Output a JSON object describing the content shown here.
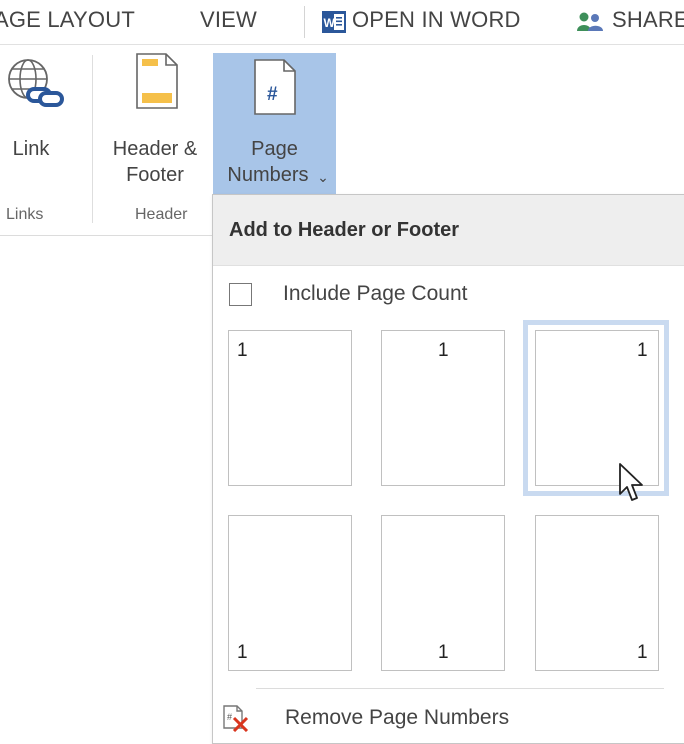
{
  "tabs": {
    "page_layout": "AGE LAYOUT",
    "view": "VIEW",
    "open_in_word": "OPEN IN WORD",
    "share": "SHARE"
  },
  "ribbon": {
    "link_label": "Link",
    "header_footer_line1": "Header &",
    "header_footer_line2": "Footer",
    "page_numbers_line1": "Page",
    "page_numbers_line2": "Numbers",
    "page_numbers_caret": "⌄",
    "groups": {
      "links": "Links",
      "header": "Header"
    }
  },
  "dropdown": {
    "header": "Add to Header or Footer",
    "include_page_count": "Include Page Count",
    "include_page_count_checked": false,
    "thumbs": [
      {
        "number": "1",
        "position": "top-left"
      },
      {
        "number": "1",
        "position": "top-center"
      },
      {
        "number": "1",
        "position": "top-right"
      },
      {
        "number": "1",
        "position": "bottom-left"
      },
      {
        "number": "1",
        "position": "bottom-center"
      },
      {
        "number": "1",
        "position": "bottom-right"
      }
    ],
    "remove_label": "Remove Page Numbers"
  },
  "colors": {
    "selected_button": "#a8c5e8",
    "hover_ring": "#c9daf0",
    "word_blue": "#2b579a",
    "remove_red": "#d9361f"
  },
  "icons": [
    "link-icon",
    "header-footer-icon",
    "page-number-icon",
    "word-icon",
    "share-icon",
    "remove-page-numbers-icon",
    "mouse-cursor-icon"
  ]
}
